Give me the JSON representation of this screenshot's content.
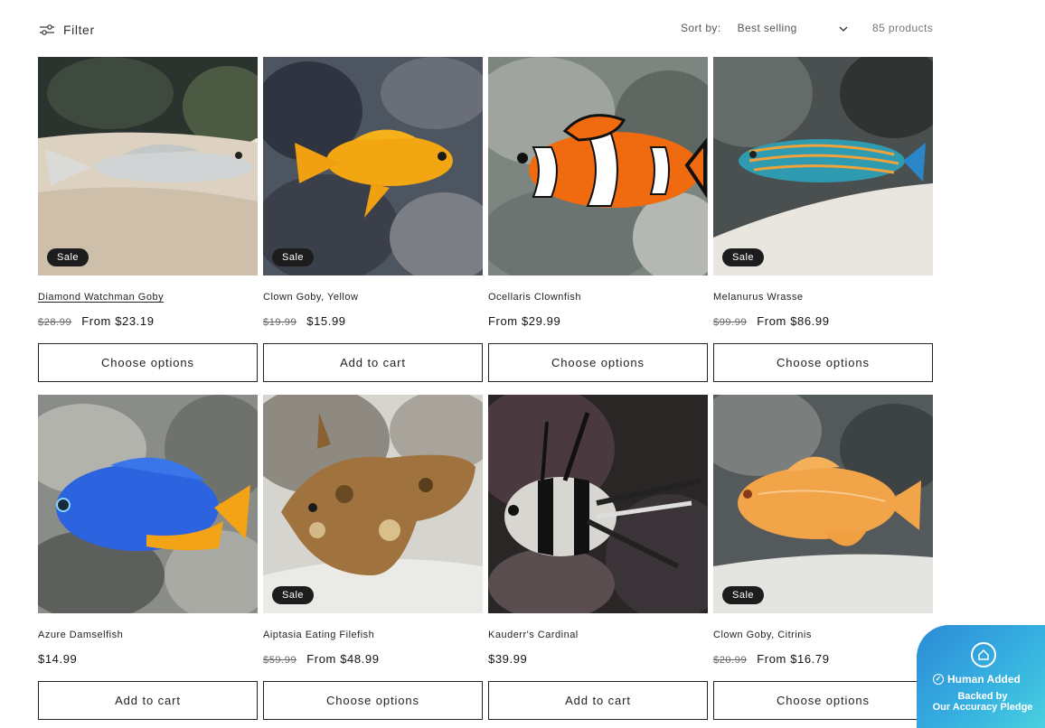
{
  "toolbar": {
    "filter_label": "Filter",
    "sort_label": "Sort by:",
    "sort_value": "Best selling",
    "product_count": "85 products"
  },
  "products": [
    {
      "name": "Diamond Watchman Goby",
      "sale": true,
      "badge": "Sale",
      "old_price": "$28.99",
      "price": "From $23.19",
      "button": "Choose options"
    },
    {
      "name": "Clown Goby, Yellow",
      "sale": true,
      "badge": "Sale",
      "old_price": "$19.99",
      "price": "$15.99",
      "button": "Add to cart"
    },
    {
      "name": "Ocellaris Clownfish",
      "sale": false,
      "price": "From $29.99",
      "button": "Choose options"
    },
    {
      "name": "Melanurus Wrasse",
      "sale": true,
      "badge": "Sale",
      "old_price": "$99.99",
      "price": "From $86.99",
      "button": "Choose options"
    },
    {
      "name": "Azure Damselfish",
      "sale": false,
      "price": "$14.99",
      "button": "Add to cart"
    },
    {
      "name": "Aiptasia Eating Filefish",
      "sale": true,
      "badge": "Sale",
      "old_price": "$59.99",
      "price": "From $48.99",
      "button": "Choose options"
    },
    {
      "name": "Kauderr's Cardinal",
      "sale": false,
      "price": "$39.99",
      "button": "Add to cart"
    },
    {
      "name": "Clown Goby, Citrinis",
      "sale": true,
      "badge": "Sale",
      "old_price": "$20.99",
      "price": "From $16.79",
      "button": "Choose options"
    }
  ],
  "pledge": {
    "line1": "Human Added",
    "line2": "Backed by",
    "line3": "Our Accuracy Pledge"
  },
  "colors": {
    "badge_bg": "#1d1d1d",
    "pledge_gradient_start": "#2c8bd6",
    "pledge_gradient_end": "#4cd4df"
  }
}
